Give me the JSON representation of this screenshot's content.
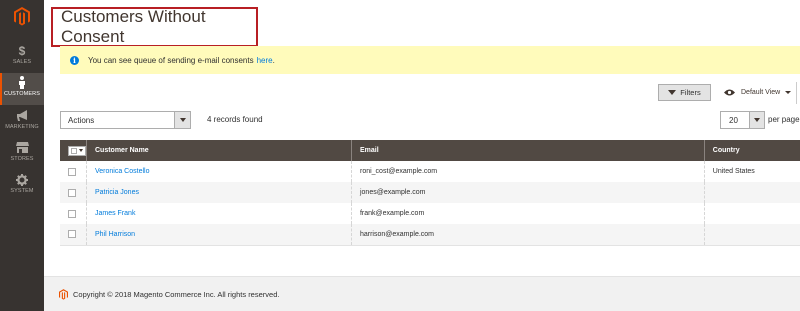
{
  "sidebar": {
    "items": [
      {
        "label": "SALES",
        "icon": "dollar-icon"
      },
      {
        "label": "CUSTOMERS",
        "icon": "person-icon"
      },
      {
        "label": "MARKETING",
        "icon": "megaphone-icon"
      },
      {
        "label": "STORES",
        "icon": "store-icon"
      },
      {
        "label": "SYSTEM",
        "icon": "gear-icon"
      }
    ]
  },
  "page": {
    "title": "Customers Without Consent"
  },
  "message": {
    "text": "You can see queue of sending e-mail consents",
    "link": "here",
    "suffix": "."
  },
  "toolbar": {
    "filters_label": "Filters",
    "view_label": "Default View",
    "actions_label": "Actions",
    "records_found": "4 records found",
    "per_page_value": "20",
    "per_page_label": "per page"
  },
  "grid": {
    "headers": {
      "name": "Customer Name",
      "email": "Email",
      "country": "Country"
    },
    "rows": [
      {
        "name": "Veronica Costello",
        "email": "roni_cost@example.com",
        "country": "United States"
      },
      {
        "name": "Patricia Jones",
        "email": "jones@example.com",
        "country": ""
      },
      {
        "name": "James Frank",
        "email": "frank@example.com",
        "country": ""
      },
      {
        "name": "Phil Harrison",
        "email": "harrison@example.com",
        "country": ""
      }
    ]
  },
  "footer": {
    "copyright": "Copyright © 2018 Magento Commerce Inc. All rights reserved."
  },
  "colors": {
    "sidebar_bg": "#373330",
    "accent": "#eb5202",
    "title_border": "#b81f24",
    "message_bg": "#fffbbb",
    "link": "#007bdb",
    "header_bg": "#514943"
  }
}
